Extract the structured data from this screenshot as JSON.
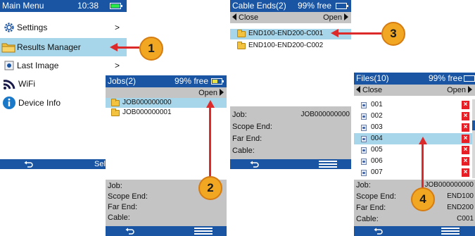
{
  "main_menu": {
    "title": "Main Menu",
    "time": "10:38",
    "items": [
      {
        "label": "Settings",
        "icon": "gear-icon",
        "chevron": ">"
      },
      {
        "label": "Results Manager",
        "icon": "folder-icon",
        "chevron": ">"
      },
      {
        "label": "Last Image",
        "icon": "image-icon",
        "chevron": ">"
      },
      {
        "label": "WiFi",
        "icon": "wifi-icon",
        "chevron": ""
      },
      {
        "label": "Device Info",
        "icon": "info-icon",
        "chevron": ""
      }
    ],
    "select_label": "Sel"
  },
  "jobs": {
    "title": "Jobs(2)",
    "status": "99% free",
    "open_label": "Open",
    "items": [
      "JOB000000000",
      "JOB000000001"
    ],
    "info": {
      "job": "Job:",
      "scope_end": "Scope End:",
      "far_end": "Far End:",
      "cable": "Cable:"
    }
  },
  "cable_ends": {
    "title": "Cable Ends(2)",
    "status": "99% free",
    "close_label": "Close",
    "open_label": "Open",
    "items": [
      "END100-END200-C001",
      "END100-END200-C002"
    ],
    "info": {
      "job": "Job:",
      "job_value": "JOB000000000",
      "scope_end": "Scope End:",
      "far_end": "Far End:",
      "cable": "Cable:"
    }
  },
  "files": {
    "title": "Files(10)",
    "status": "99% free",
    "close_label": "Close",
    "open_label": "Open",
    "items": [
      "001",
      "002",
      "003",
      "004",
      "005",
      "006",
      "007"
    ],
    "delete_label": "×",
    "info": {
      "job": "Job:",
      "job_value": "JOB000000000",
      "scope_end": "Scope End:",
      "scope_end_value": "END100",
      "far_end": "Far End:",
      "far_end_value": "END200",
      "cable": "Cable:",
      "cable_value": "C001"
    }
  },
  "callouts": [
    "1",
    "2",
    "3",
    "4"
  ],
  "colors": {
    "title_bar": "#1a55a3",
    "selection": "#a7d6ea",
    "info_panel": "#c4c4c4",
    "callout": "#f2a723",
    "arrow": "#dc2a2a",
    "delete": "#e61e25"
  }
}
